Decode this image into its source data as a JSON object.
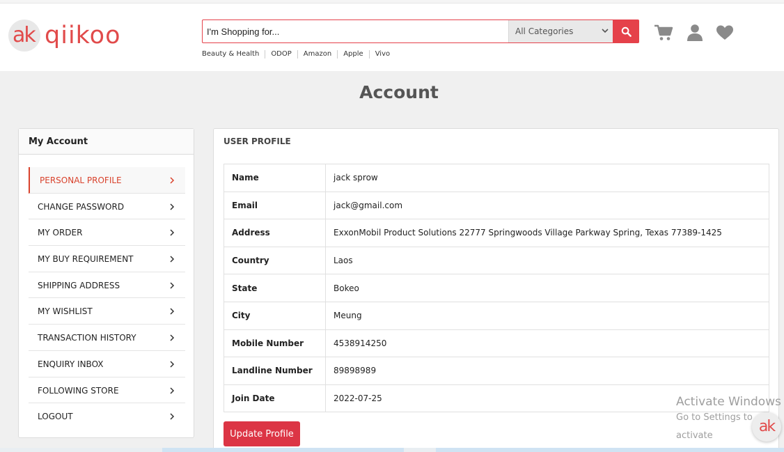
{
  "brand": {
    "logo_text": "qiikoo",
    "logo_mark": "ak"
  },
  "search": {
    "placeholder": "I'm Shopping for...",
    "category": "All Categories"
  },
  "quick_links": [
    "Beauty & Health",
    "ODOP",
    "Amazon",
    "Apple",
    "Vivo"
  ],
  "header_icons": [
    "cart-icon",
    "user-icon",
    "heart-icon"
  ],
  "page": {
    "title": "Account"
  },
  "sidebar": {
    "title": "My Account",
    "items": [
      {
        "label": "PERSONAL PROFILE",
        "active": true
      },
      {
        "label": "CHANGE PASSWORD"
      },
      {
        "label": "MY ORDER"
      },
      {
        "label": "MY BUY REQUIREMENT"
      },
      {
        "label": "SHIPPING ADDRESS"
      },
      {
        "label": "MY WISHLIST"
      },
      {
        "label": "TRANSACTION HISTORY"
      },
      {
        "label": "ENQUIRY INBOX"
      },
      {
        "label": "FOLLOWING STORE"
      },
      {
        "label": "LOGOUT"
      }
    ]
  },
  "profile": {
    "heading": "USER PROFILE",
    "rows": [
      {
        "label": "Name",
        "value": "jack sprow"
      },
      {
        "label": "Email",
        "value": "jack@gmail.com"
      },
      {
        "label": "Address",
        "value": "ExxonMobil Product Solutions 22777 Springwoods Village Parkway Spring, Texas 77389-1425"
      },
      {
        "label": "Country",
        "value": "Laos"
      },
      {
        "label": "State",
        "value": "Bokeo"
      },
      {
        "label": "City",
        "value": "Meung"
      },
      {
        "label": "Mobile Number",
        "value": "4538914250"
      },
      {
        "label": "Landline Number",
        "value": "89898989"
      },
      {
        "label": "Join Date",
        "value": "2022-07-25"
      }
    ],
    "update_label": "Update Profile"
  },
  "watermark": {
    "title": "Activate Windows",
    "subtitle": "Go to Settings to activate"
  },
  "colors": {
    "accent": "#e5414a",
    "button": "#dc3545",
    "active_menu": "#d9422c"
  }
}
